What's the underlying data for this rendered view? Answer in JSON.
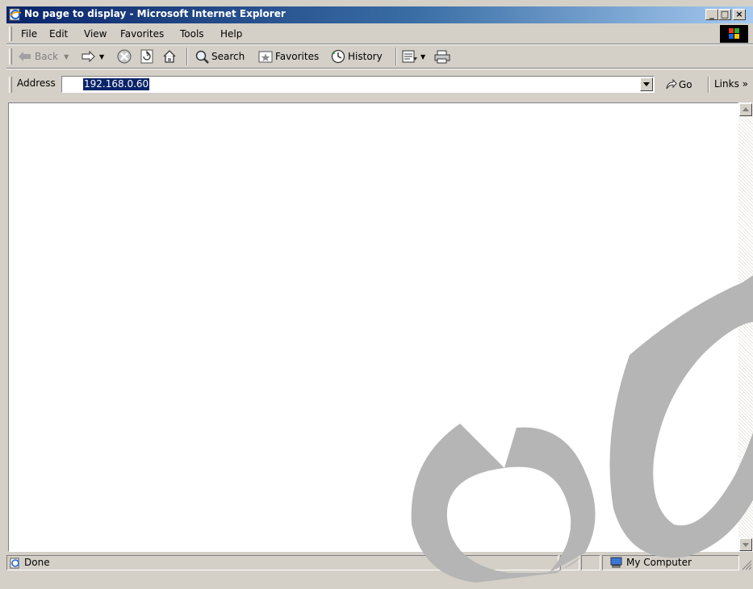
{
  "window": {
    "title": "No page to display - Microsoft Internet Explorer",
    "controls": {
      "minimize": "_",
      "maximize": "□",
      "close": "×"
    }
  },
  "menu": {
    "items": [
      "File",
      "Edit",
      "View",
      "Favorites",
      "Tools",
      "Help"
    ]
  },
  "toolbar": {
    "back_label": "Back",
    "search_label": "Search",
    "favorites_label": "Favorites",
    "history_label": "History"
  },
  "address": {
    "label": "Address",
    "value": "192.168.0.60",
    "go_label": "Go",
    "links_label": "Links »"
  },
  "status": {
    "text": "Done",
    "zone": "My Computer"
  },
  "colors": {
    "title_start": "#0a246a",
    "title_end": "#a6caf0",
    "chrome": "#d4d0c8",
    "selection": "#0a246a",
    "watermark": "#b5b5b5"
  },
  "icons": [
    "ie-page-icon",
    "back-arrow-icon",
    "forward-arrow-icon",
    "stop-icon",
    "refresh-icon",
    "home-icon",
    "search-icon",
    "favorites-icon",
    "history-icon",
    "mail-icon",
    "print-icon",
    "go-arrow-icon",
    "windows-logo-icon",
    "my-computer-icon",
    "ie-page-small-icon"
  ]
}
